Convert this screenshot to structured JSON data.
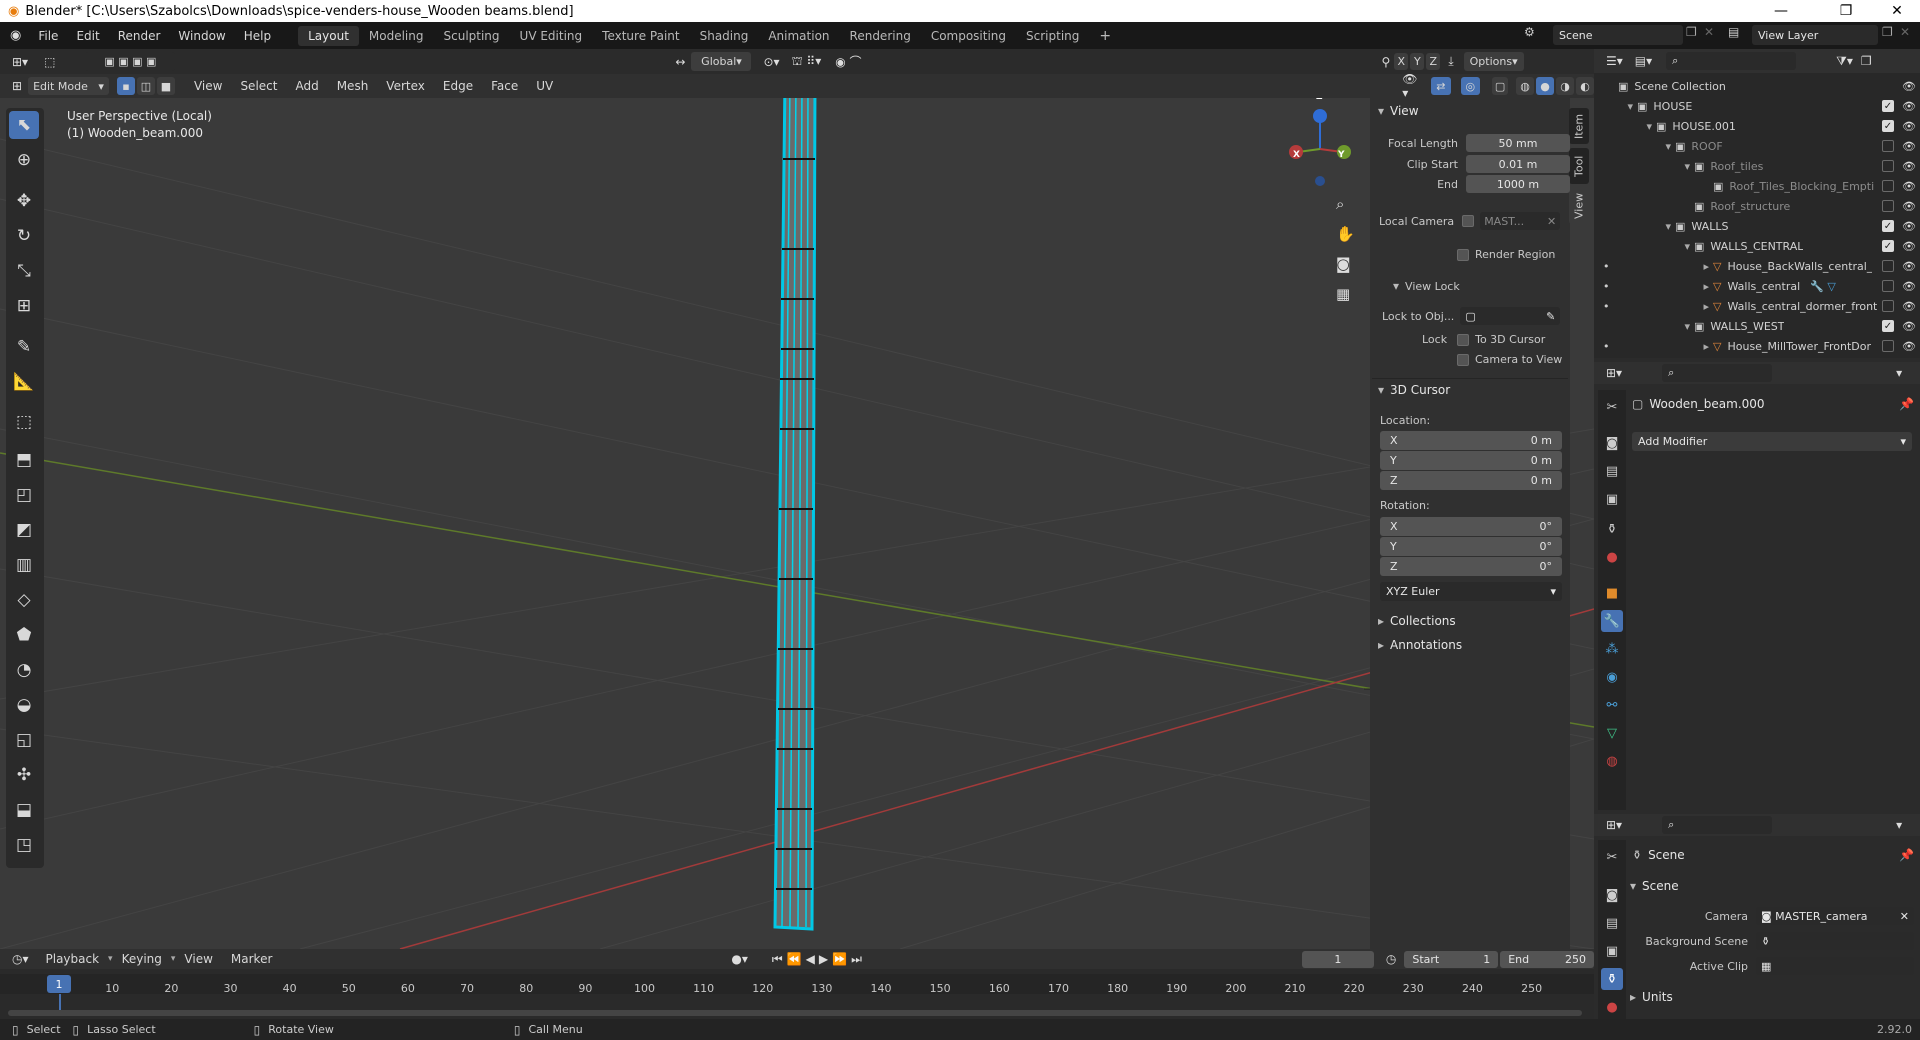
{
  "window": {
    "title": "Blender* [C:\\Users\\Szabolcs\\Downloads\\spice-venders-house_Wooden beams.blend]",
    "minimize": "—",
    "maximize": "❐",
    "close": "✕"
  },
  "menus": [
    "File",
    "Edit",
    "Render",
    "Window",
    "Help"
  ],
  "workspaces": [
    "Layout",
    "Modeling",
    "Sculpting",
    "UV Editing",
    "Texture Paint",
    "Shading",
    "Animation",
    "Rendering",
    "Compositing",
    "Scripting"
  ],
  "active_workspace": "Layout",
  "scene": {
    "label": "Scene",
    "view_layer": "View Layer"
  },
  "viewport_header": {
    "mode": "Edit Mode",
    "menus": [
      "View",
      "Select",
      "Add",
      "Mesh",
      "Vertex",
      "Edge",
      "Face",
      "UV"
    ],
    "orientation": "Global",
    "options": "Options",
    "axes": [
      "X",
      "Y",
      "Z"
    ]
  },
  "viewport": {
    "perspective": "User Perspective (Local)",
    "object": "(1) Wooden_beam.000",
    "gizmo_z": "Z",
    "gizmo_y": "Y",
    "gizmo_x": "X"
  },
  "npanel": {
    "tabs": [
      "Item",
      "Tool",
      "View"
    ],
    "view_header": "View",
    "focal_length_label": "Focal Length",
    "focal_length": "50 mm",
    "clip_start_label": "Clip Start",
    "clip_start": "0.01 m",
    "clip_end_label": "End",
    "clip_end": "1000 m",
    "local_camera_label": "Local Camera",
    "local_camera": "MAST...",
    "render_region": "Render Region",
    "view_lock": "View Lock",
    "lock_to_obj": "Lock to Obj...",
    "lock_label": "Lock",
    "to_3d_cursor": "To 3D Cursor",
    "camera_to_view": "Camera to View",
    "cursor_header": "3D Cursor",
    "location_label": "Location:",
    "loc": [
      {
        "axis": "X",
        "value": "0 m"
      },
      {
        "axis": "Y",
        "value": "0 m"
      },
      {
        "axis": "Z",
        "value": "0 m"
      }
    ],
    "rotation_label": "Rotation:",
    "rot": [
      {
        "axis": "X",
        "value": "0°"
      },
      {
        "axis": "Y",
        "value": "0°"
      },
      {
        "axis": "Z",
        "value": "0°"
      }
    ],
    "rotation_mode": "XYZ Euler",
    "collections": "Collections",
    "annotations": "Annotations"
  },
  "outliner": {
    "rows": [
      {
        "label": "Scene Collection",
        "checked": false
      },
      {
        "label": "HOUSE",
        "checked": true
      },
      {
        "label": "HOUSE.001",
        "checked": true
      },
      {
        "label": "ROOF",
        "checked": false
      },
      {
        "label": "Roof_tiles",
        "checked": false
      },
      {
        "label": "Roof_Tiles_Blocking_Empti",
        "checked": false
      },
      {
        "label": "Roof_structure",
        "checked": false
      },
      {
        "label": "WALLS",
        "checked": true
      },
      {
        "label": "WALLS_CENTRAL",
        "checked": true
      },
      {
        "label": "House_BackWalls_central_",
        "checked": false
      },
      {
        "label": "Walls_central",
        "checked": false
      },
      {
        "label": "Walls_central_dormer_front",
        "checked": false
      },
      {
        "label": "WALLS_WEST",
        "checked": true
      },
      {
        "label": "House_MillTower_FrontDor",
        "checked": false
      }
    ]
  },
  "properties": {
    "object_name": "Wooden_beam.000",
    "add_modifier": "Add Modifier"
  },
  "scene_props": {
    "name": "Scene",
    "section": "Scene",
    "camera_label": "Camera",
    "camera": "MASTER_camera",
    "background_label": "Background Scene",
    "clip_label": "Active Clip",
    "units": "Units"
  },
  "timeline": {
    "menus": [
      "Playback",
      "Keying",
      "View",
      "Marker"
    ],
    "frame": "1",
    "start_label": "Start",
    "start": "1",
    "end_label": "End",
    "end": "250",
    "ticks": [
      "1",
      "10",
      "20",
      "30",
      "40",
      "50",
      "60",
      "70",
      "80",
      "90",
      "100",
      "110",
      "120",
      "130",
      "140",
      "150",
      "160",
      "170",
      "180",
      "190",
      "200",
      "210",
      "220",
      "230",
      "240",
      "250"
    ]
  },
  "status": {
    "select": "Select",
    "lasso": "Lasso Select",
    "rotate": "Rotate View",
    "call_menu": "Call Menu",
    "version": "2.92.0"
  }
}
